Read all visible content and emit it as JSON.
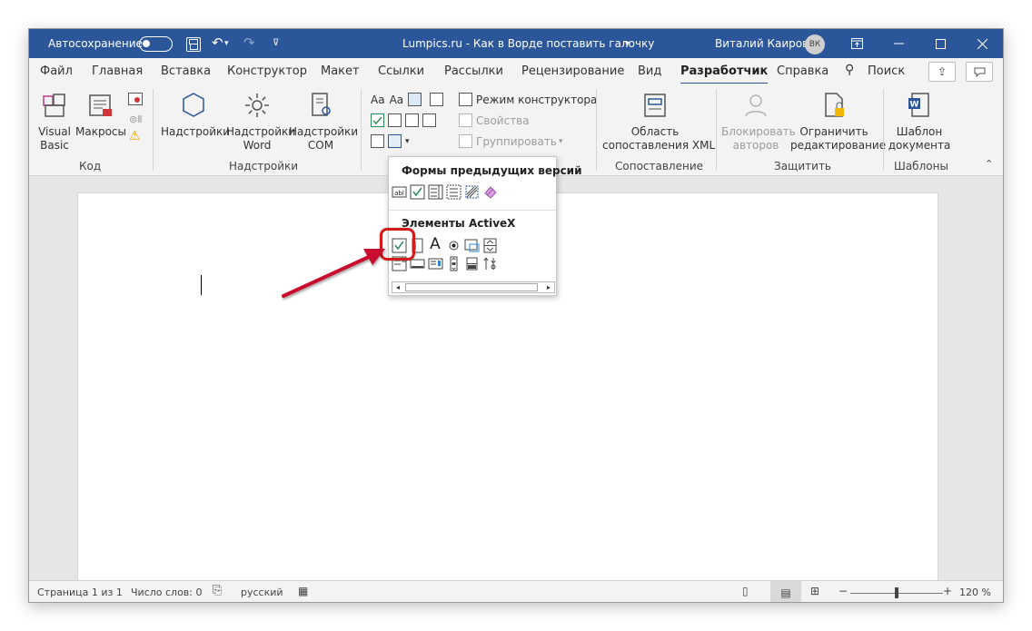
{
  "titlebar": {
    "autosave_label": "Автосохранение",
    "doc_title": "Lumpics.ru - Как в Ворде поставить галочку",
    "doc_title_caret": "▾",
    "user_name": "Виталий Каиров",
    "avatar_initials": "ВК",
    "undo_glyph": "↶",
    "redo_glyph": "↷",
    "qat_more": "⊽",
    "accent": "#2b579a"
  },
  "tabs": [
    {
      "label": "Файл"
    },
    {
      "label": "Главная"
    },
    {
      "label": "Вставка"
    },
    {
      "label": "Конструктор"
    },
    {
      "label": "Макет"
    },
    {
      "label": "Ссылки"
    },
    {
      "label": "Рассылки"
    },
    {
      "label": "Рецензирование"
    },
    {
      "label": "Вид"
    },
    {
      "label": "Разработчик"
    },
    {
      "label": "Справка"
    },
    {
      "label": "Поиск"
    }
  ],
  "ribbon": {
    "code": {
      "visual_basic": "Visual\nBasic",
      "macros": "Макросы",
      "label": "Код"
    },
    "addins": {
      "addins": "Надстройки",
      "word_addins": "Надстройки\nWord",
      "com_addins": "Надстройки\nCOM",
      "label": "Надстройки"
    },
    "controls": {
      "design_mode": "Режим конструктора",
      "properties": "Свойства",
      "group": "Группировать",
      "aa1": "Aa",
      "aa2": "Aa"
    },
    "mapping": {
      "xml_pane": "Область\nсопоставления XML",
      "label": "Сопоставление"
    },
    "protect": {
      "block_authors": "Блокировать\nавторов",
      "restrict_editing": "Ограничить\nредактирование",
      "label": "Защитить"
    },
    "templates": {
      "doc_template": "Шаблон\nдокумента",
      "label": "Шаблоны"
    }
  },
  "dropdown": {
    "legacy_heading": "Формы предыдущих версий",
    "activex_heading": "Элементы ActiveX",
    "activex_label_glyph": "A"
  },
  "status": {
    "page": "Страница 1 из 1",
    "words": "Число слов: 0",
    "language": "русский",
    "zoom": "120 %",
    "zoom_minus": "−",
    "zoom_plus": "+"
  },
  "colors": {
    "highlight": "#d21b1b",
    "check_green": "#2e8b57"
  }
}
